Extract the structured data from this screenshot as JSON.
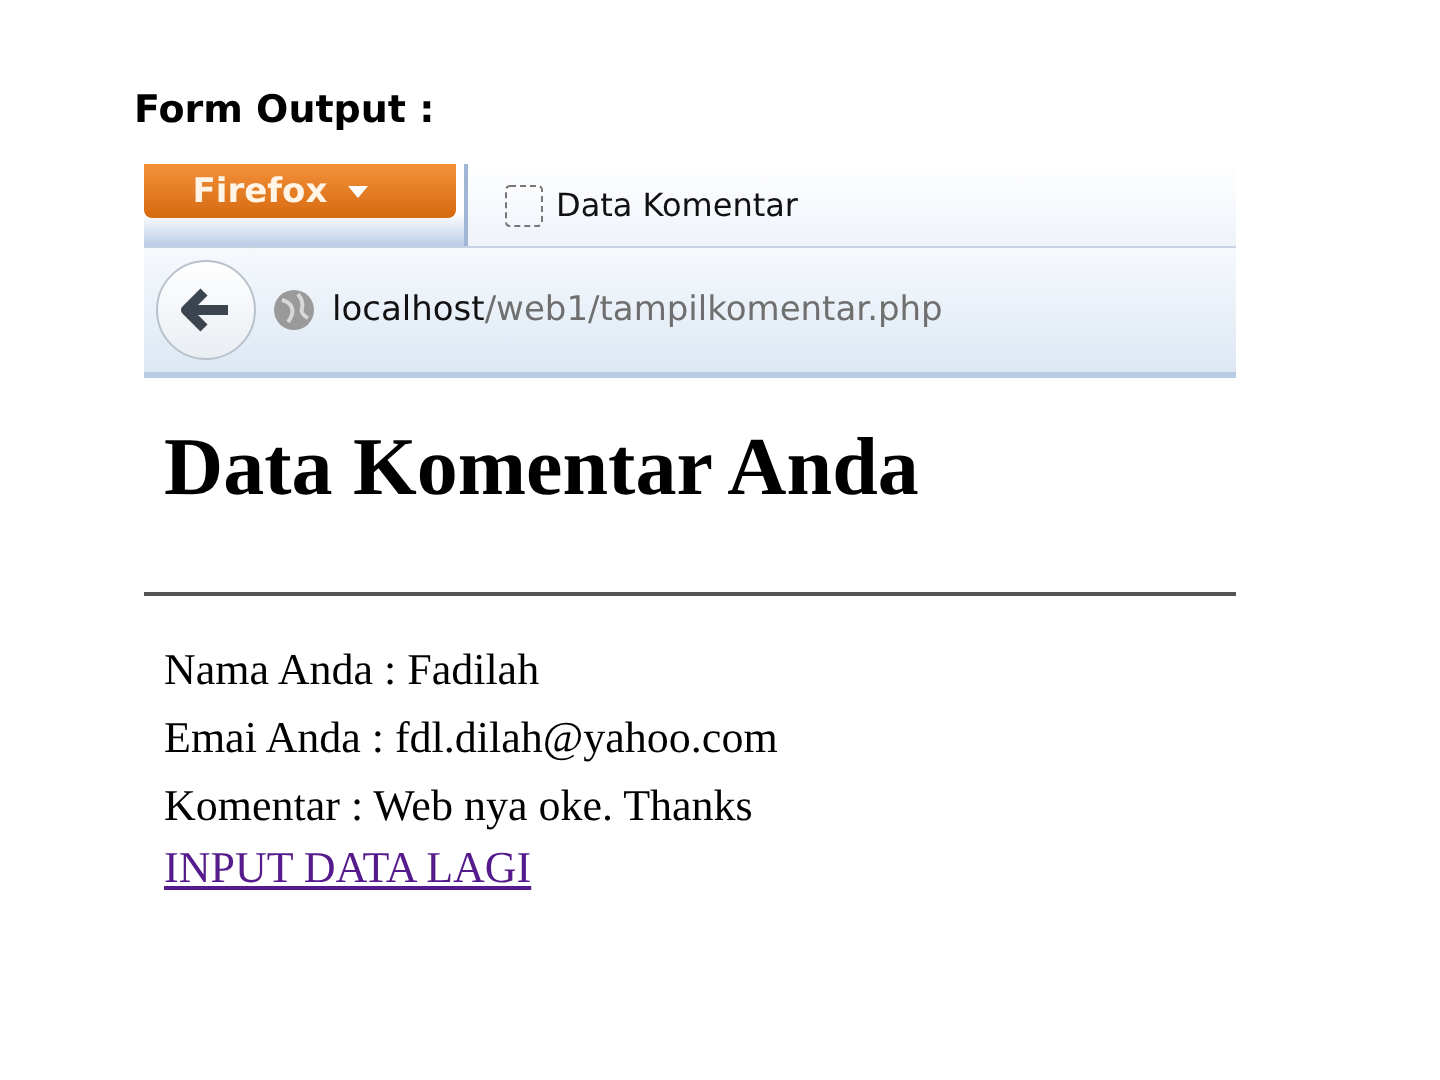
{
  "caption": "Form Output :",
  "browser": {
    "app_menu": "Firefox",
    "tab": {
      "title": "Data Komentar"
    },
    "address": {
      "host": "localhost",
      "path": "/web1/tampilkomentar.php"
    }
  },
  "page": {
    "heading": "Data Komentar Anda",
    "lines": [
      "Nama Anda : Fadilah",
      "Emai Anda : fdl.dilah@yahoo.com",
      "Komentar : Web nya oke. Thanks"
    ],
    "link": "INPUT DATA LAGI"
  }
}
